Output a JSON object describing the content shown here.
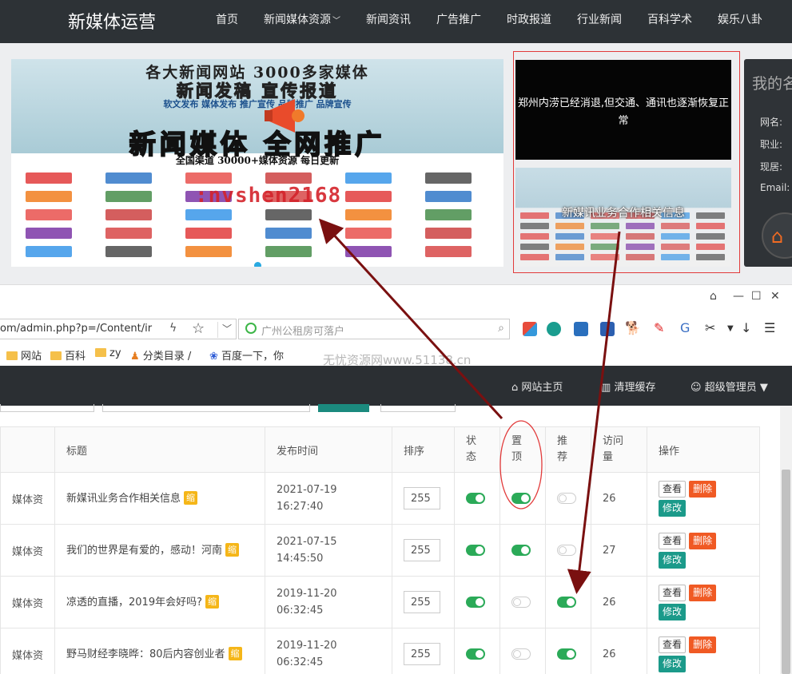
{
  "site": {
    "logo": "新媒体运营",
    "menu": [
      "首页",
      "新闻媒体资源",
      "新闻资讯",
      "广告推广",
      "时政报道",
      "行业新闻",
      "百科学术",
      "娱乐八卦"
    ]
  },
  "banner": {
    "line1": "各大新闻网站  3000多家媒体",
    "line2": "新闻发稿  宣传报道",
    "line3": "软文发布 媒体发布 推广宣传 品牌推广 品牌宣传",
    "line4": "新闻媒体  全网推广",
    "sub": "全国渠道  30000+媒体资源 每日更新",
    "watermark": ":nvshen2168"
  },
  "news": {
    "headline": "郑州内涝已经消退,但交通、通讯也逐渐恢复正常",
    "caption": "新媒讯业务合作相关信息"
  },
  "profile": {
    "title": "我的名",
    "labels": [
      "网名:",
      "职业:",
      "现居:",
      "Email:"
    ]
  },
  "browser": {
    "url": "om/admin.php?p=/Content/ir",
    "search_placeholder": "广州公租房可落户",
    "bookmarks": [
      "网站",
      "百科",
      "zy",
      "分类目录 /",
      "百度一下，你"
    ],
    "watermark": "无忧资源网www.51138.cn"
  },
  "admin": {
    "home_link": "网站主页",
    "clear_cache": "清理缓存",
    "user": "超级管理员"
  },
  "table": {
    "headers": {
      "title": "标题",
      "time": "发布时间",
      "sort": "排序",
      "status": "状\n态",
      "top": "置\n顶",
      "recommend": "推\n荐",
      "views": "访问\n量",
      "ops": "操作"
    },
    "rows": [
      {
        "category": "媒体资",
        "title": "新媒讯业务合作相关信息",
        "badge": "缩",
        "date": "2021-07-19",
        "time": "16:27:40",
        "sort": "255",
        "status": true,
        "top": true,
        "recommend": false,
        "views": "26"
      },
      {
        "category": "媒体资",
        "title": "我们的世界是有爱的，感动！河南",
        "badge": "缩",
        "date": "2021-07-15",
        "time": "14:45:50",
        "sort": "255",
        "status": true,
        "top": true,
        "recommend": false,
        "views": "27"
      },
      {
        "category": "媒体资",
        "title": "凉透的直播，2019年会好吗?",
        "badge": "缩",
        "date": "2019-11-20",
        "time": "06:32:45",
        "sort": "255",
        "status": true,
        "top": false,
        "recommend": true,
        "views": "26"
      },
      {
        "category": "媒体资",
        "title": "野马财经李晓晔：80后内容创业者",
        "badge": "缩",
        "date": "2019-11-20",
        "time": "06:32:45",
        "sort": "255",
        "status": true,
        "top": false,
        "recommend": true,
        "views": "26"
      }
    ],
    "buttons": {
      "view": "查看",
      "delete": "删除",
      "edit": "修改"
    }
  },
  "colors": {
    "annotation": "#7a1010",
    "switch_on": "#2baa58",
    "badge": "#f5b618",
    "delete": "#f05a24",
    "edit": "#1b9a8a"
  }
}
